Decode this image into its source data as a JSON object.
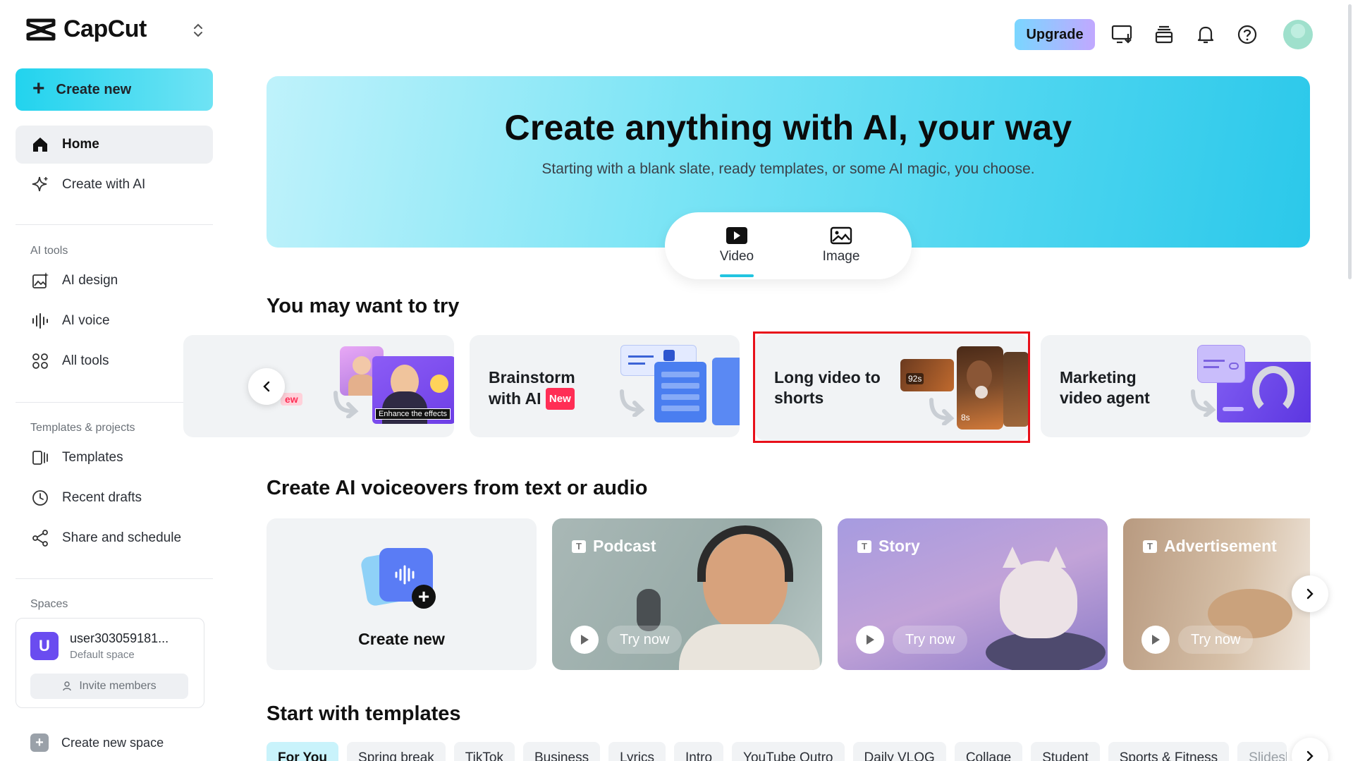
{
  "brand": {
    "name": "CapCut"
  },
  "sidebar": {
    "create_new": "Create new",
    "home": "Home",
    "create_with_ai": "Create with AI",
    "ai_tools_label": "AI tools",
    "ai_design": "AI design",
    "ai_voice": "AI voice",
    "all_tools": "All tools",
    "templates_label": "Templates & projects",
    "templates": "Templates",
    "recent_drafts": "Recent drafts",
    "share_schedule": "Share and schedule",
    "spaces_label": "Spaces",
    "space": {
      "avatar_letter": "U",
      "name": "user303059181...",
      "sub": "Default space",
      "invite": "Invite members"
    },
    "create_new_space": "Create new space"
  },
  "topbar": {
    "upgrade": "Upgrade"
  },
  "hero": {
    "title": "Create anything with AI, your way",
    "subtitle": "Starting with a blank slate, ready templates, or some AI magic, you choose.",
    "tabs": [
      "Video",
      "Image"
    ],
    "active_tab": "Video"
  },
  "try_section": {
    "title": "You may want to try",
    "partial_badge": "ew",
    "enhance_caption": "Enhance the effects",
    "cards": [
      {
        "line1": "Brainstorm",
        "line2": "with AI",
        "badge": "New"
      },
      {
        "line1": "Long video to",
        "line2": "shorts",
        "durations": [
          "92s",
          "8s"
        ]
      },
      {
        "line1": "Marketing",
        "line2": "video agent"
      }
    ]
  },
  "voice_section": {
    "title": "Create AI voiceovers from text or audio",
    "create_new": "Create new",
    "cards": [
      {
        "label": "Podcast",
        "cta": "Try now"
      },
      {
        "label": "Story",
        "cta": "Try now"
      },
      {
        "label": "Advertisement",
        "cta": "Try now"
      }
    ]
  },
  "templates_section": {
    "title": "Start with templates",
    "chips": [
      "For You",
      "Spring break",
      "TikTok",
      "Business",
      "Lyrics",
      "Intro",
      "YouTube Outro",
      "Daily VLOG",
      "Collage",
      "Student",
      "Sports & Fitness",
      "Slideshow"
    ],
    "active_chip": "For You"
  },
  "colors": {
    "accent": "#22c5e0",
    "new_badge": "#ff2e55",
    "highlight": "#e8101a",
    "space_avatar": "#6a4cf0"
  }
}
